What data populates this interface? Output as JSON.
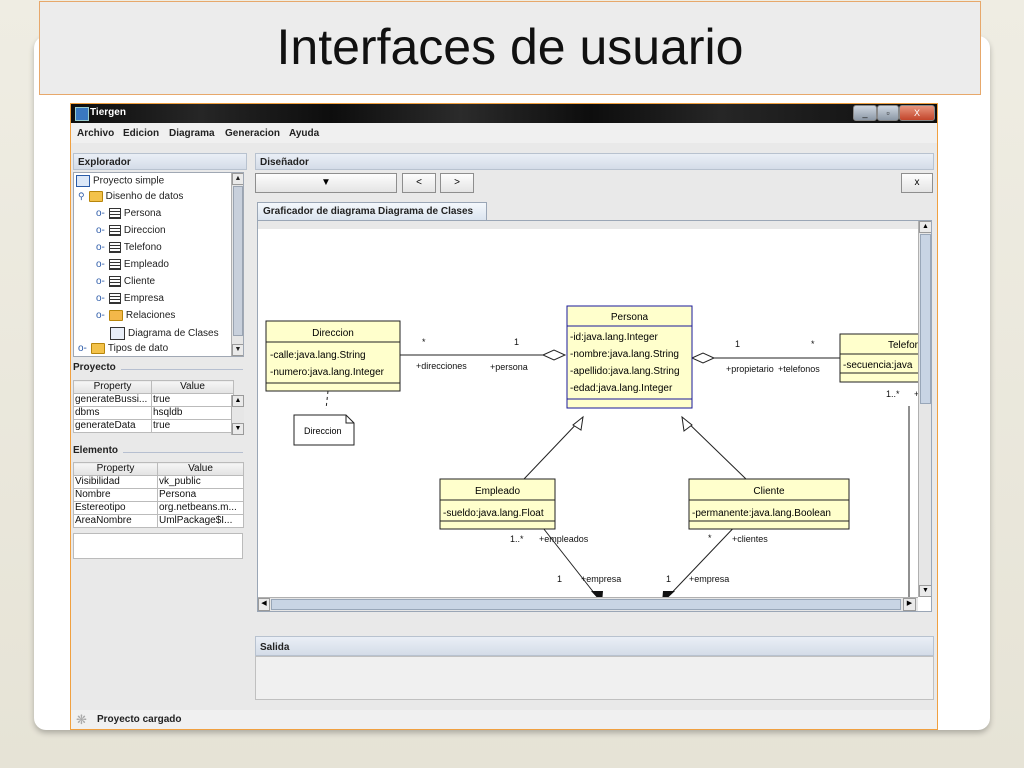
{
  "slide": {
    "title": "Interfaces de usuario"
  },
  "window": {
    "title": "Tiergen",
    "controls": {
      "minimize": "_",
      "maximize": "▫",
      "close": "X"
    }
  },
  "menubar": [
    "Archivo",
    "Edicion",
    "Diagrama",
    "Generacion",
    "Ayuda"
  ],
  "explorer": {
    "header": "Explorador",
    "tree": [
      {
        "label": "Proyecto simple",
        "icon": "project-icon"
      },
      {
        "label": "Disenho de datos",
        "icon": "folder-icon"
      },
      {
        "label": "Persona",
        "icon": "table-icon"
      },
      {
        "label": "Direccion",
        "icon": "table-icon"
      },
      {
        "label": "Telefono",
        "icon": "table-icon"
      },
      {
        "label": "Empleado",
        "icon": "table-icon"
      },
      {
        "label": "Cliente",
        "icon": "table-icon"
      },
      {
        "label": "Empresa",
        "icon": "table-icon"
      },
      {
        "label": "Relaciones",
        "icon": "folder-relations-icon"
      },
      {
        "label": "Diagrama de Clases",
        "icon": "diagram-icon"
      },
      {
        "label": "Tipos de dato",
        "icon": "folder-icon"
      }
    ]
  },
  "project": {
    "header": "Proyecto",
    "columns": [
      "Property",
      "Value"
    ],
    "rows": [
      [
        "generateBussi...",
        "true"
      ],
      [
        "dbms",
        "hsqldb"
      ],
      [
        "generateData",
        "true"
      ]
    ]
  },
  "element": {
    "header": "Elemento",
    "columns": [
      "Property",
      "Value"
    ],
    "rows": [
      [
        "Visibilidad",
        "vk_public"
      ],
      [
        "Nombre",
        "Persona"
      ],
      [
        "Estereotipo",
        "org.netbeans.m..."
      ],
      [
        "AreaNombre",
        "UmlPackage$I..."
      ]
    ]
  },
  "designer": {
    "header": "Diseñador",
    "nav_prev": "<",
    "nav_next": ">",
    "close": "x",
    "tab": "Graficador de diagrama Diagrama de Clases"
  },
  "diagram": {
    "classes": [
      {
        "name": "Persona",
        "attrs": [
          "-id:java.lang.Integer",
          "-nombre:java.lang.String",
          "-apellido:java.lang.String",
          "-edad:java.lang.Integer"
        ]
      },
      {
        "name": "Direccion",
        "attrs": [
          "-calle:java.lang.String",
          "-numero:java.lang.Integer"
        ]
      },
      {
        "name": "Telefor",
        "attrs": [
          "-secuencia:java"
        ]
      },
      {
        "name": "Empleado",
        "attrs": [
          "-sueldo:java.lang.Float"
        ]
      },
      {
        "name": "Cliente",
        "attrs": [
          "-permanente:java.lang.Boolean"
        ]
      }
    ],
    "note": "Direccion",
    "labels": {
      "dir_star": "*",
      "dir_one": "1",
      "direcciones": "+direcciones",
      "persona_role": "+persona",
      "tel_one": "1",
      "tel_star": "*",
      "propietario": "+propietario",
      "telefonos": "+telefonos",
      "tel_mult": "1..*",
      "tel_plus": "+",
      "emp_mult": "1..*",
      "empleados": "+empleados",
      "cli_star": "*",
      "clientes": "+clientes",
      "empresa_one_a": "1",
      "empresa_a": "+empresa",
      "empresa_one_b": "1",
      "empresa_b": "+empresa"
    }
  },
  "output": {
    "header": "Salida"
  },
  "status": {
    "text": "Proyecto cargado"
  }
}
